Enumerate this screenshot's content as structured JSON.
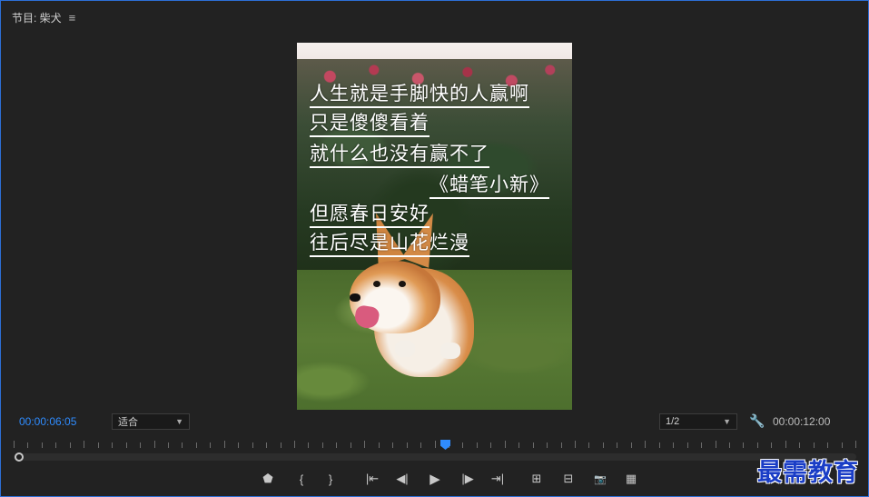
{
  "panel": {
    "title": "节目: 柴犬",
    "menu_icon": "hamburger-icon",
    "accent_color": "#2d6fd6"
  },
  "frame": {
    "captions": [
      "人生就是手脚快的人赢啊",
      "只是傻傻看着",
      "就什么也没有赢不了",
      "《蜡笔小新》",
      "但愿春日安好",
      "往后尽是山花烂漫"
    ]
  },
  "controls": {
    "current_timecode": "00:00:06:05",
    "zoom_select": "适合",
    "resolution_select": "1/2",
    "settings_icon": "wrench-icon",
    "duration_timecode": "00:00:12:00",
    "playhead_color": "#2f8cff",
    "playhead_fraction": 0.514
  },
  "transport": {
    "buttons": [
      {
        "name": "add-marker",
        "icon": "marker-icon",
        "glyph": "⬟"
      },
      {
        "name": "mark-in",
        "icon": "mark-in-icon",
        "glyph": "{"
      },
      {
        "name": "mark-out",
        "icon": "mark-out-icon",
        "glyph": "}"
      },
      {
        "name": "go-to-in",
        "icon": "go-to-in-icon",
        "glyph": "|⇤"
      },
      {
        "name": "step-back",
        "icon": "step-back-icon",
        "glyph": "◀|"
      },
      {
        "name": "play",
        "icon": "play-icon",
        "glyph": "▶"
      },
      {
        "name": "step-forward",
        "icon": "step-forward-icon",
        "glyph": "|▶"
      },
      {
        "name": "go-to-out",
        "icon": "go-to-out-icon",
        "glyph": "⇥|"
      },
      {
        "name": "lift",
        "icon": "lift-icon",
        "glyph": "⊞"
      },
      {
        "name": "extract",
        "icon": "extract-icon",
        "glyph": "⊟"
      },
      {
        "name": "export-frame",
        "icon": "camera-icon",
        "glyph": "📷"
      },
      {
        "name": "compare-view",
        "icon": "compare-icon",
        "glyph": "▦"
      }
    ],
    "add_icon": "plus-icon"
  },
  "watermark": {
    "text": "最需教育",
    "color": "#1a3dc6"
  }
}
